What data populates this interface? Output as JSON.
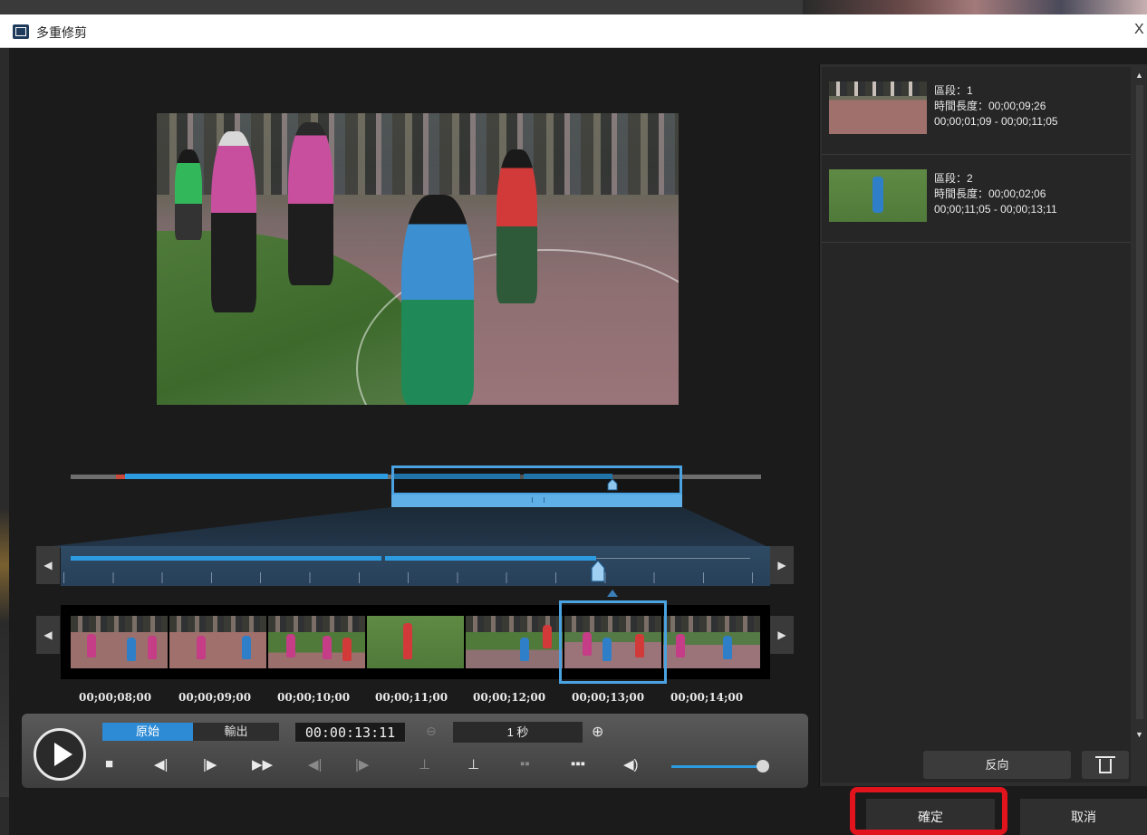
{
  "window": {
    "title": "多重修剪",
    "close": "X"
  },
  "player": {
    "mode_tabs": [
      "原始",
      "輸出"
    ],
    "current_time": "00:00:13:11",
    "scale": "1 秒"
  },
  "timeline": {
    "timecodes": [
      "00;00;08;00",
      "00;00;09;00",
      "00;00;10;00",
      "00;00;11;00",
      "00;00;12;00",
      "00;00;13;00",
      "00;00;14;00"
    ]
  },
  "clips": [
    {
      "segment": "區段：1",
      "duration": "時間長度：00;00;09;26",
      "range": "00;00;01;09 - 00;00;11;05"
    },
    {
      "segment": "區段：2",
      "duration": "時間長度：00;00;02;06",
      "range": "00;00;11;05 - 00;00;13;11"
    }
  ],
  "panel_buttons": {
    "reverse": "反向"
  },
  "dialog_buttons": {
    "ok": "確定",
    "cancel": "取消"
  },
  "colors": {
    "accent_blue": "#2d9be0",
    "highlight_red": "#e1141e"
  },
  "icons": [
    "play-icon",
    "stop-icon",
    "prev-frame-icon",
    "next-frame-icon",
    "fast-forward-icon",
    "mark-in-icon",
    "mark-out-icon",
    "zoom-in-icon",
    "zoom-out-icon",
    "volume-icon",
    "trash-icon"
  ]
}
